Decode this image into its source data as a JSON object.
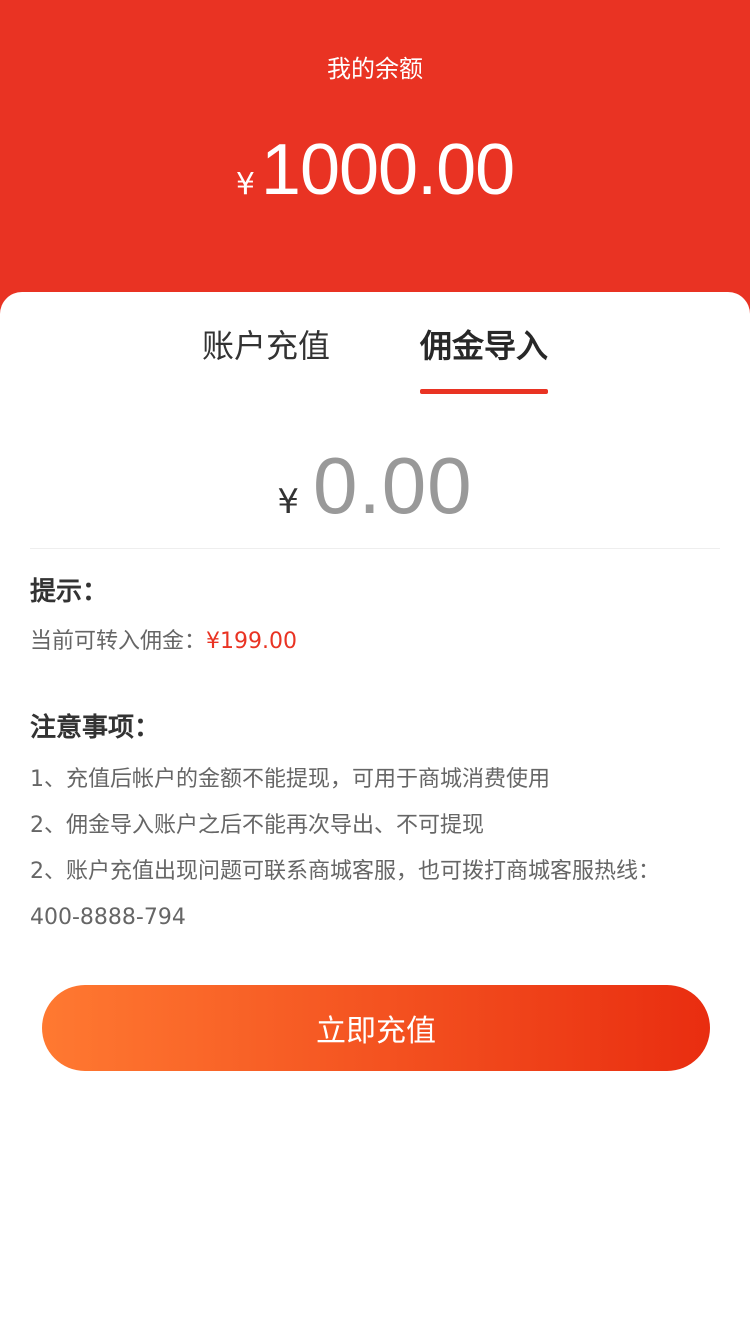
{
  "header": {
    "title": "我的余额",
    "currency": "¥",
    "balance": "1000.00"
  },
  "tabs": [
    {
      "label": "账户充值",
      "active": false
    },
    {
      "label": "佣金导入",
      "active": true
    }
  ],
  "amount": {
    "currency": "¥",
    "value": "0.00"
  },
  "tips": {
    "title": "提示：",
    "label": "当前可转入佣金：",
    "value": "¥199.00"
  },
  "notes": {
    "title": "注意事项：",
    "items": [
      "1、充值后帐户的金额不能提现，可用于商城消费使用",
      "2、佣金导入账户之后不能再次导出、不可提现",
      "2、账户充值出现问题可联系商城客服，也可拨打商城客服热线：",
      "400-8888-794"
    ]
  },
  "button": {
    "label": "立即充值"
  },
  "colors": {
    "primary": "#e93323",
    "gradient_start": "#ff7931",
    "gradient_end": "#e92d10"
  }
}
